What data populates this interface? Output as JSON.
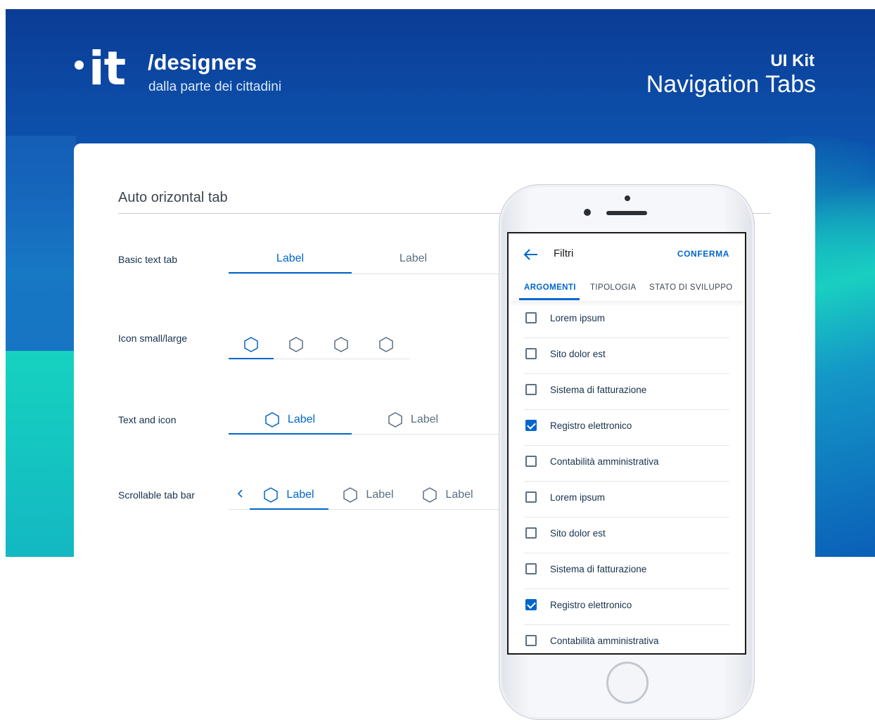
{
  "header": {
    "brand_mark": "it",
    "brand_title": "/designers",
    "brand_subtitle": "dalla parte dei cittadini",
    "kit_label": "UI Kit",
    "kit_title": "Navigation Tabs"
  },
  "section": {
    "title": "Auto orizontal tab"
  },
  "rows": {
    "basic": {
      "label": "Basic text tab",
      "tab1": "Label",
      "tab2": "Label"
    },
    "icon": {
      "label": "Icon small/large"
    },
    "text_icon": {
      "label": "Text and icon",
      "tab1": "Label",
      "tab2": "Label"
    },
    "scroll": {
      "label": "Scrollable tab bar",
      "tab1": "Label",
      "tab2": "Label",
      "tab3": "Label"
    }
  },
  "phone": {
    "title": "Filtri",
    "confirm": "CONFERMA",
    "tabs": [
      "ARGOMENTI",
      "TIPOLOGIA",
      "STATO DI SVILUPPO"
    ],
    "active_tab": "ARGOMENTI",
    "items": [
      {
        "label": "Lorem ipsum",
        "checked": false
      },
      {
        "label": "Sito dolor est",
        "checked": false
      },
      {
        "label": "Sistema di fatturazione",
        "checked": false
      },
      {
        "label": "Registro elettronico",
        "checked": true
      },
      {
        "label": "Contabilità amministrativa",
        "checked": false
      },
      {
        "label": "Lorem ipsum",
        "checked": false
      },
      {
        "label": "Sito dolor est",
        "checked": false
      },
      {
        "label": "Sistema di fatturazione",
        "checked": false
      },
      {
        "label": "Registro elettronico",
        "checked": true
      },
      {
        "label": "Contabilità amministrativa",
        "checked": false
      }
    ]
  },
  "colors": {
    "primary": "#0066cc",
    "hero_dark": "#0b3c95",
    "teal": "#16d2c0",
    "text": "#17324d"
  },
  "icons": {
    "tab_icon": "hexagon-icon",
    "back_icon": "arrow-left-icon",
    "scroll_prev_icon": "chevron-left-icon"
  }
}
